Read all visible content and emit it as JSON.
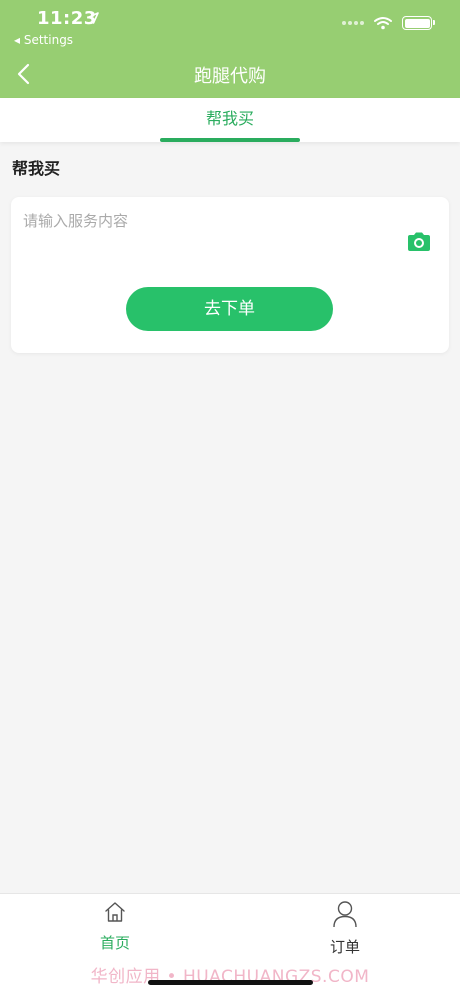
{
  "status_bar": {
    "time": "11:23",
    "back_label": "◂ Settings"
  },
  "header": {
    "title": "跑腿代购"
  },
  "tabs": [
    {
      "label": "帮我买",
      "active": true
    }
  ],
  "section": {
    "title": "帮我买"
  },
  "form": {
    "placeholder": "请输入服务内容",
    "submit_label": "去下单"
  },
  "bottom_nav": [
    {
      "label": "首页",
      "icon": "home-icon",
      "active": true
    },
    {
      "label": "订单",
      "icon": "user-icon",
      "active": false
    }
  ],
  "watermark": "华创应用 • HUACHUANGZS.COM",
  "colors": {
    "header_bg": "#97ce72",
    "accent": "#2aac5e",
    "button": "#28c16a",
    "background": "#f5f5f5"
  }
}
